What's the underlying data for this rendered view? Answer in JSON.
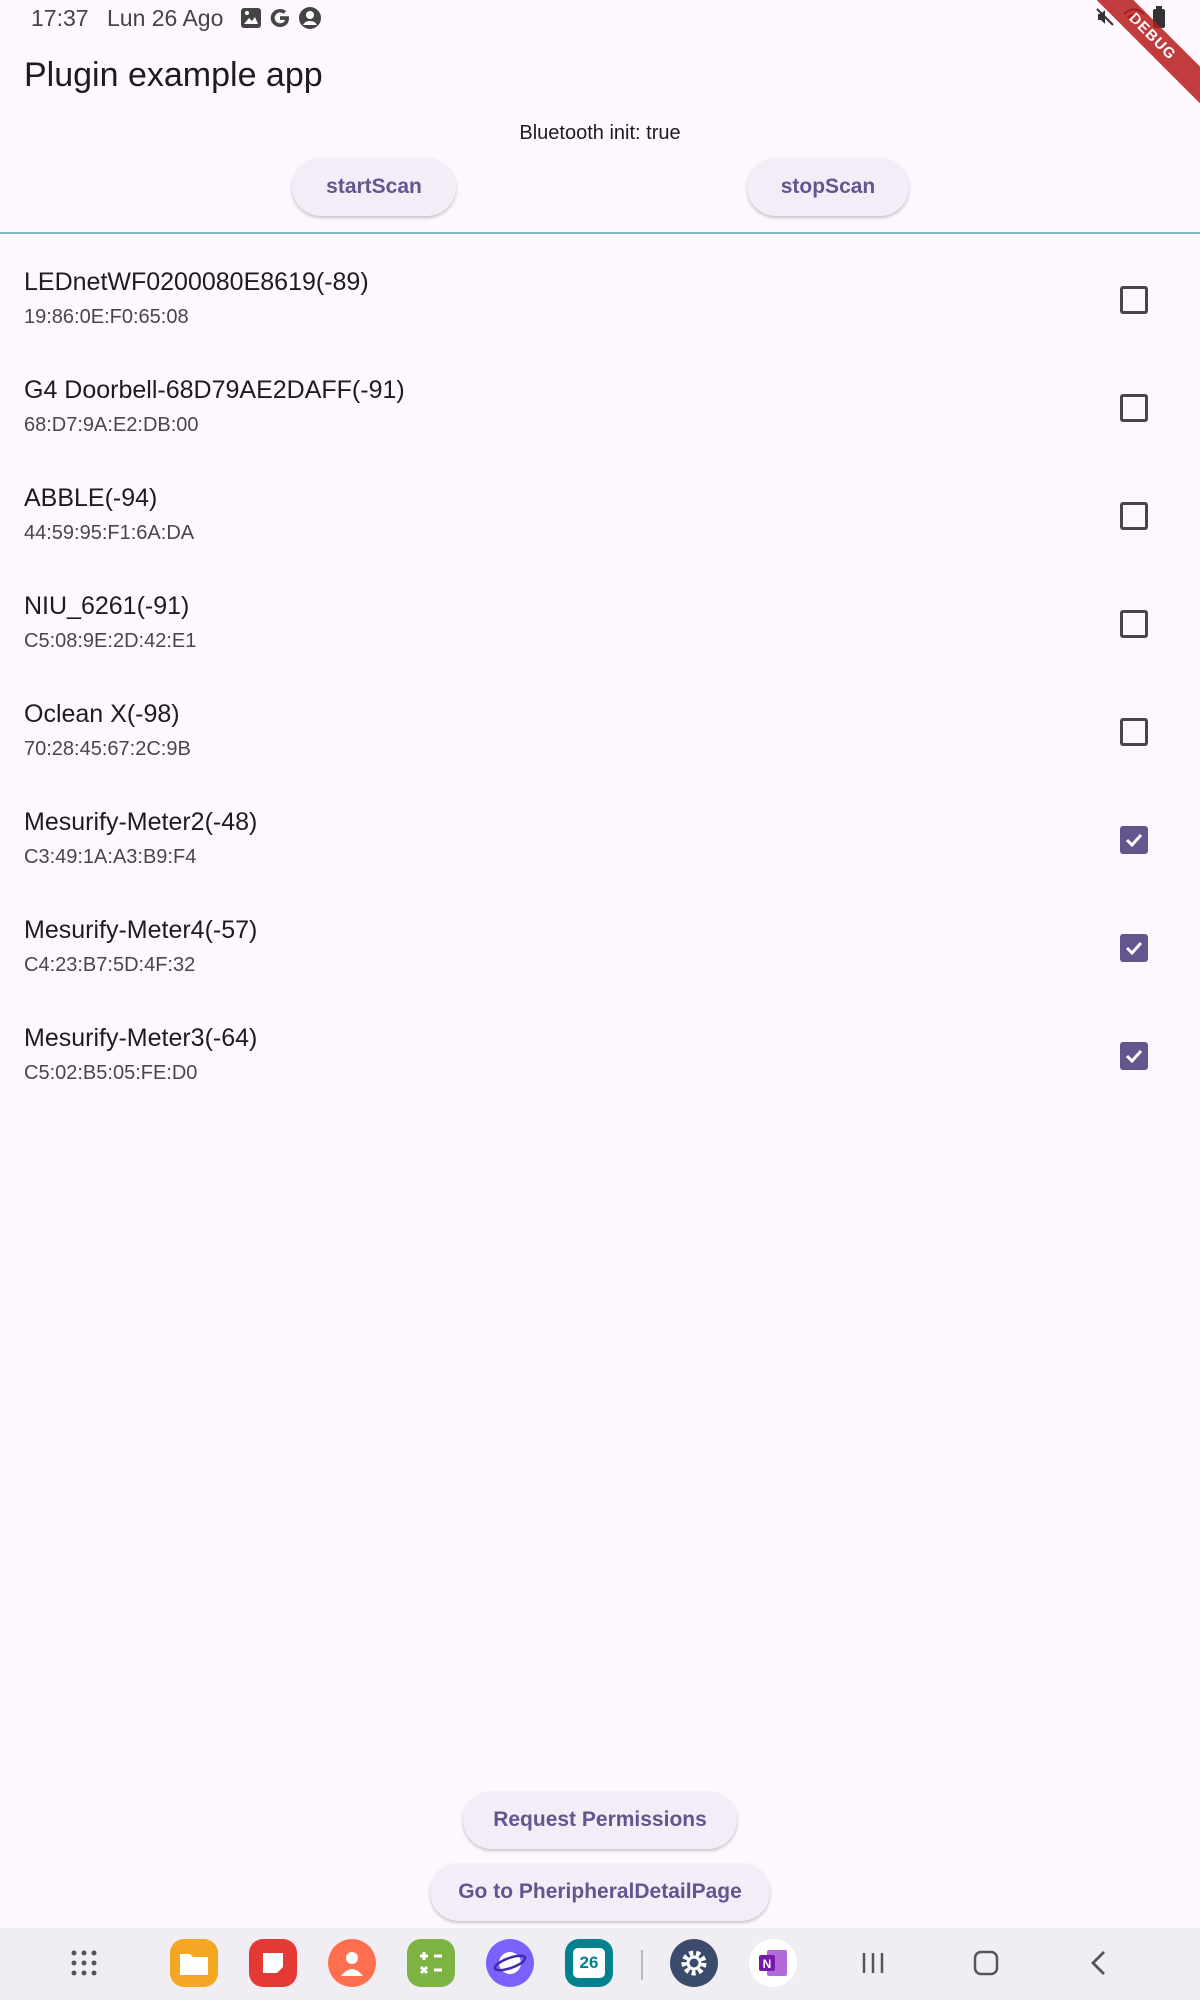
{
  "status_bar": {
    "time": "17:37",
    "date": "Lun 26 Ago",
    "debug_label": "DEBUG"
  },
  "app_bar": {
    "title": "Plugin example app"
  },
  "bluetooth": {
    "status_text": "Bluetooth init: true",
    "start_label": "startScan",
    "stop_label": "stopScan"
  },
  "devices": [
    {
      "name": "LEDnetWF0200080E8619(-89)",
      "mac": "19:86:0E:F0:65:08",
      "checked": false
    },
    {
      "name": "G4 Doorbell-68D79AE2DAFF(-91)",
      "mac": "68:D7:9A:E2:DB:00",
      "checked": false
    },
    {
      "name": "ABBLE(-94)",
      "mac": "44:59:95:F1:6A:DA",
      "checked": false
    },
    {
      "name": "NIU_6261(-91)",
      "mac": "C5:08:9E:2D:42:E1",
      "checked": false
    },
    {
      "name": "Oclean X(-98)",
      "mac": "70:28:45:67:2C:9B",
      "checked": false
    },
    {
      "name": "Mesurify-Meter2(-48)",
      "mac": "C3:49:1A:A3:B9:F4",
      "checked": true
    },
    {
      "name": "Mesurify-Meter4(-57)",
      "mac": "C4:23:B7:5D:4F:32",
      "checked": true
    },
    {
      "name": "Mesurify-Meter3(-64)",
      "mac": "C5:02:B5:05:FE:D0",
      "checked": true
    }
  ],
  "actions": {
    "request_permissions_label": "Request Permissions",
    "go_detail_label": "Go to PheripheralDetailPage"
  },
  "nav_bar": {
    "calendar_day": "26",
    "apps": [
      "app-drawer-icon",
      "files-icon",
      "notes-icon",
      "contacts-icon",
      "calculator-icon",
      "internet-icon",
      "calendar-icon",
      "settings-icon",
      "onenote-icon",
      "recents-icon",
      "home-icon",
      "back-icon"
    ]
  },
  "colors": {
    "accent": "#65558f",
    "background": "#fef7ff",
    "divider": "#7fb6c9"
  }
}
